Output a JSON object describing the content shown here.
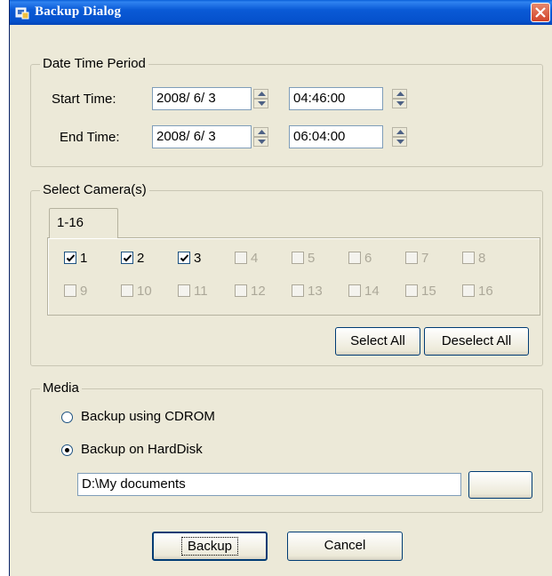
{
  "window": {
    "title": "Backup Dialog"
  },
  "date_time_period": {
    "legend": "Date Time Period",
    "start_label": "Start Time:",
    "start_date": "2008/ 6/ 3",
    "start_time": "04:46:00",
    "end_label": "End Time:",
    "end_date": "2008/ 6/ 3",
    "end_time": "06:04:00"
  },
  "select_cameras": {
    "legend": "Select Camera(s)",
    "tab_label": "1-16",
    "cameras": [
      {
        "label": "1",
        "checked": true,
        "enabled": true
      },
      {
        "label": "2",
        "checked": true,
        "enabled": true
      },
      {
        "label": "3",
        "checked": true,
        "enabled": true
      },
      {
        "label": "4",
        "checked": false,
        "enabled": false
      },
      {
        "label": "5",
        "checked": false,
        "enabled": false
      },
      {
        "label": "6",
        "checked": false,
        "enabled": false
      },
      {
        "label": "7",
        "checked": false,
        "enabled": false
      },
      {
        "label": "8",
        "checked": false,
        "enabled": false
      },
      {
        "label": "9",
        "checked": false,
        "enabled": false
      },
      {
        "label": "10",
        "checked": false,
        "enabled": false
      },
      {
        "label": "11",
        "checked": false,
        "enabled": false
      },
      {
        "label": "12",
        "checked": false,
        "enabled": false
      },
      {
        "label": "13",
        "checked": false,
        "enabled": false
      },
      {
        "label": "14",
        "checked": false,
        "enabled": false
      },
      {
        "label": "15",
        "checked": false,
        "enabled": false
      },
      {
        "label": "16",
        "checked": false,
        "enabled": false
      }
    ],
    "select_all_label": "Select All",
    "deselect_all_label": "Deselect All"
  },
  "media": {
    "legend": "Media",
    "option_cdrom": "Backup using CDROM",
    "option_harddisk": "Backup on HardDisk",
    "selected": "harddisk",
    "path_value": "D:\\My documents"
  },
  "footer": {
    "backup_label": "Backup",
    "cancel_label": "Cancel"
  },
  "colors": {
    "titlebar": "#0a5ad6",
    "dialog_bg": "#ece9d8",
    "close_button": "#d2442a"
  }
}
